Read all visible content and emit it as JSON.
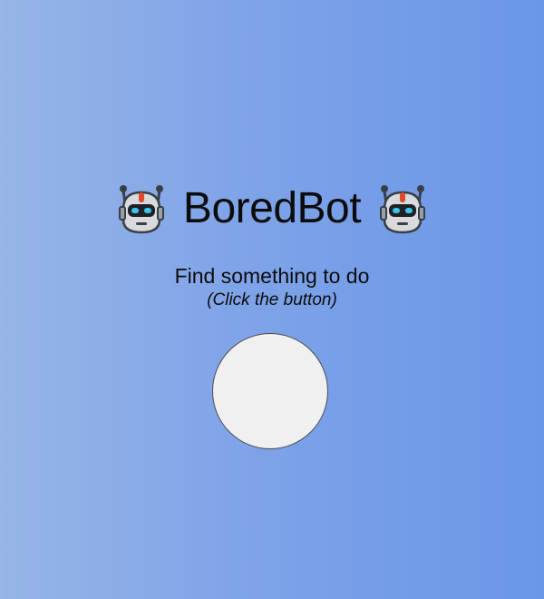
{
  "header": {
    "title": "BoredBot",
    "left_icon": "robot-face-icon",
    "right_icon": "robot-face-icon"
  },
  "prompt": {
    "heading": "Find something to do",
    "hint": "(Click the button)"
  },
  "action_button": {
    "label": ""
  },
  "colors": {
    "background_left": "#97b5e6",
    "background_right": "#6a97e8",
    "button_fill": "#f0f0f0",
    "button_border": "#4c4c4c",
    "text": "#0c0c0c"
  }
}
